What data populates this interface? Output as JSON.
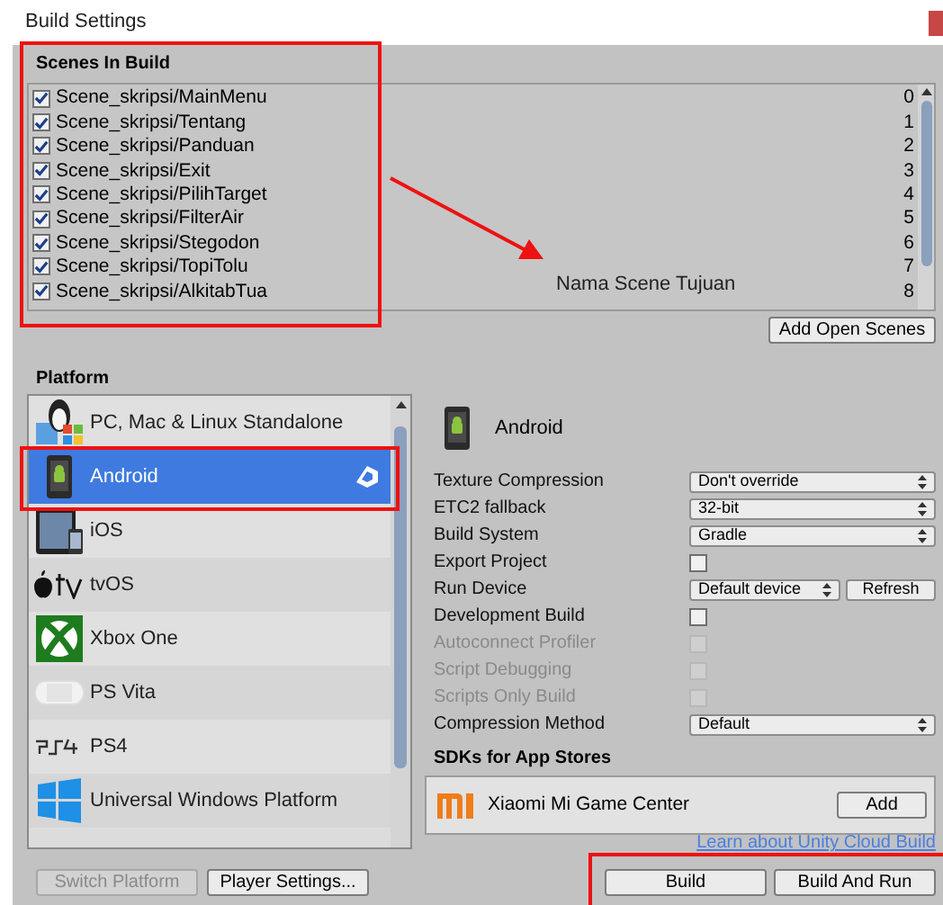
{
  "window": {
    "title": "Build Settings"
  },
  "scenes_in_build": {
    "heading": "Scenes In Build",
    "scenes": [
      {
        "path": "Scene_skripsi/MainMenu",
        "index": "0",
        "checked": true
      },
      {
        "path": "Scene_skripsi/Tentang",
        "index": "1",
        "checked": true
      },
      {
        "path": "Scene_skripsi/Panduan",
        "index": "2",
        "checked": true
      },
      {
        "path": "Scene_skripsi/Exit",
        "index": "3",
        "checked": true
      },
      {
        "path": "Scene_skripsi/PilihTarget",
        "index": "4",
        "checked": true
      },
      {
        "path": "Scene_skripsi/FilterAir",
        "index": "5",
        "checked": true
      },
      {
        "path": "Scene_skripsi/Stegodon",
        "index": "6",
        "checked": true
      },
      {
        "path": "Scene_skripsi/TopiTolu",
        "index": "7",
        "checked": true
      },
      {
        "path": "Scene_skripsi/AlkitabTua",
        "index": "8",
        "checked": true
      }
    ],
    "add_button": "Add Open Scenes"
  },
  "annotation": {
    "label": "Nama Scene Tujuan"
  },
  "platform": {
    "heading": "Platform",
    "items": [
      {
        "label": "PC, Mac & Linux Standalone",
        "kind": "standalone",
        "selected": false,
        "current": false
      },
      {
        "label": "Android",
        "kind": "android",
        "selected": true,
        "current": true
      },
      {
        "label": "iOS",
        "kind": "ios",
        "selected": false,
        "current": false
      },
      {
        "label": "tvOS",
        "kind": "tvos",
        "selected": false,
        "current": false
      },
      {
        "label": "Xbox One",
        "kind": "xbox",
        "selected": false,
        "current": false
      },
      {
        "label": "PS Vita",
        "kind": "psvita",
        "selected": false,
        "current": false
      },
      {
        "label": "PS4",
        "kind": "ps4",
        "selected": false,
        "current": false
      },
      {
        "label": "Universal Windows Platform",
        "kind": "windows",
        "selected": false,
        "current": false
      }
    ]
  },
  "settings": {
    "title": "Android",
    "rows": [
      {
        "label": "Texture Compression",
        "kind": "dropdown",
        "value": "Don't override",
        "disabled": false
      },
      {
        "label": "ETC2 fallback",
        "kind": "dropdown",
        "value": "32-bit",
        "disabled": false
      },
      {
        "label": "Build System",
        "kind": "dropdown",
        "value": "Gradle",
        "disabled": false
      },
      {
        "label": "Export Project",
        "kind": "checkbox",
        "checked": false,
        "disabled": false
      },
      {
        "label": "Run Device",
        "kind": "device",
        "value": "Default device",
        "button": "Refresh",
        "disabled": false
      },
      {
        "label": "Development Build",
        "kind": "checkbox",
        "checked": false,
        "disabled": false
      },
      {
        "label": "Autoconnect Profiler",
        "kind": "checkbox",
        "checked": false,
        "disabled": true
      },
      {
        "label": "Script Debugging",
        "kind": "checkbox",
        "checked": false,
        "disabled": true
      },
      {
        "label": "Scripts Only Build",
        "kind": "checkbox",
        "checked": false,
        "disabled": true
      },
      {
        "label": "Compression Method",
        "kind": "dropdown",
        "value": "Default",
        "disabled": false
      }
    ]
  },
  "sdks": {
    "heading": "SDKs for App Stores",
    "items": [
      {
        "name": "Xiaomi Mi Game Center",
        "button": "Add"
      }
    ]
  },
  "cloud_link": "Learn about Unity Cloud Build",
  "left_buttons": [
    {
      "label": "Switch Platform",
      "disabled": true
    },
    {
      "label": "Player Settings...",
      "disabled": false
    }
  ],
  "right_buttons": [
    {
      "label": "Build",
      "disabled": false
    },
    {
      "label": "Build And Run",
      "disabled": false
    }
  ]
}
